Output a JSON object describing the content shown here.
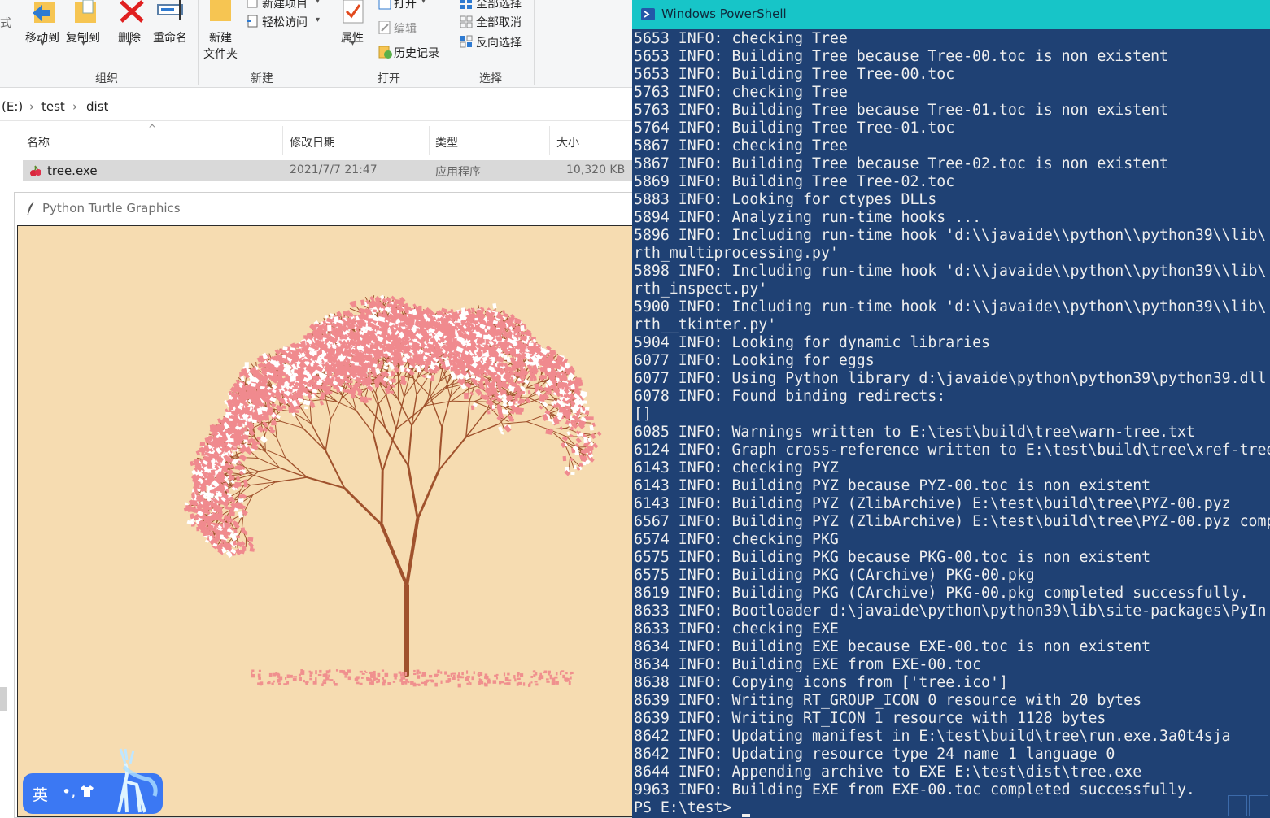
{
  "explorer": {
    "ribbon": {
      "cut_label": "式",
      "move_to": "移动到",
      "copy_to": "复制到",
      "delete": "删除",
      "rename": "重命名",
      "new_folder_line1": "新建",
      "new_folder_line2": "文件夹",
      "new_item": "新建项目",
      "easy_access": "轻松访问",
      "properties": "属性",
      "open": "打开",
      "edit": "编辑",
      "history": "历史记录",
      "select_all": "全部选择",
      "select_none": "全部取消",
      "invert_selection": "反向选择",
      "group_organize": "组织",
      "group_new": "新建",
      "group_open": "打开",
      "group_select": "选择",
      "dropdown_glyph": "▾"
    },
    "address": {
      "drive": "(E:)",
      "sep": "›",
      "part1": "test",
      "part2": "dist"
    },
    "columns": {
      "name": "名称",
      "modified": "修改日期",
      "type": "类型",
      "size": "大小",
      "sort_glyph": "^"
    },
    "file": {
      "name": "tree.exe",
      "modified": "2021/7/7 21:47",
      "type": "应用程序",
      "size": "10,320 KB"
    }
  },
  "turtle": {
    "title": "Python Turtle Graphics",
    "colors": {
      "background": "#f6dcb1",
      "trunk": "#a0522d",
      "blossom": "#f08a8e",
      "petal_white": "#ffffff",
      "fallen": "#f0908e"
    }
  },
  "ime": {
    "lang": "英",
    "punct": "•,",
    "skin_icon": "shirt-icon"
  },
  "powershell": {
    "title": "Windows PowerShell",
    "lines": [
      "5653 INFO: checking Tree",
      "5653 INFO: Building Tree because Tree-00.toc is non existent",
      "5653 INFO: Building Tree Tree-00.toc",
      "5763 INFO: checking Tree",
      "5763 INFO: Building Tree because Tree-01.toc is non existent",
      "5764 INFO: Building Tree Tree-01.toc",
      "5867 INFO: checking Tree",
      "5867 INFO: Building Tree because Tree-02.toc is non existent",
      "5869 INFO: Building Tree Tree-02.toc",
      "5883 INFO: Looking for ctypes DLLs",
      "5894 INFO: Analyzing run-time hooks ...",
      "5896 INFO: Including run-time hook 'd:\\\\javaide\\\\python\\\\python39\\\\lib\\",
      "rth_multiprocessing.py'",
      "5898 INFO: Including run-time hook 'd:\\\\javaide\\\\python\\\\python39\\\\lib\\",
      "rth_inspect.py'",
      "5900 INFO: Including run-time hook 'd:\\\\javaide\\\\python\\\\python39\\\\lib\\",
      "rth__tkinter.py'",
      "5904 INFO: Looking for dynamic libraries",
      "6077 INFO: Looking for eggs",
      "6077 INFO: Using Python library d:\\javaide\\python\\python39\\python39.dll",
      "6078 INFO: Found binding redirects:",
      "[]",
      "6085 INFO: Warnings written to E:\\test\\build\\tree\\warn-tree.txt",
      "6124 INFO: Graph cross-reference written to E:\\test\\build\\tree\\xref-tree",
      "6143 INFO: checking PYZ",
      "6143 INFO: Building PYZ because PYZ-00.toc is non existent",
      "6143 INFO: Building PYZ (ZlibArchive) E:\\test\\build\\tree\\PYZ-00.pyz",
      "6567 INFO: Building PYZ (ZlibArchive) E:\\test\\build\\tree\\PYZ-00.pyz comp",
      "6574 INFO: checking PKG",
      "6575 INFO: Building PKG because PKG-00.toc is non existent",
      "6575 INFO: Building PKG (CArchive) PKG-00.pkg",
      "8619 INFO: Building PKG (CArchive) PKG-00.pkg completed successfully.",
      "8633 INFO: Bootloader d:\\javaide\\python\\python39\\lib\\site-packages\\PyIn",
      "8633 INFO: checking EXE",
      "8634 INFO: Building EXE because EXE-00.toc is non existent",
      "8634 INFO: Building EXE from EXE-00.toc",
      "8638 INFO: Copying icons from ['tree.ico']",
      "8639 INFO: Writing RT_GROUP_ICON 0 resource with 20 bytes",
      "8639 INFO: Writing RT_ICON 1 resource with 1128 bytes",
      "8642 INFO: Updating manifest in E:\\test\\build\\tree\\run.exe.3a0t4sja",
      "8642 INFO: Updating resource type 24 name 1 language 0",
      "8644 INFO: Appending archive to EXE E:\\test\\dist\\tree.exe",
      "9963 INFO: Building EXE from EXE-00.toc completed successfully."
    ],
    "prompt": "PS E:\\test> "
  }
}
